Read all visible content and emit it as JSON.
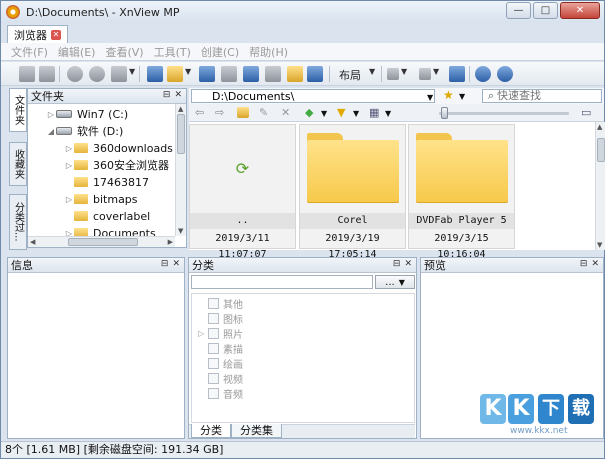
{
  "window": {
    "title": "D:\\Documents\\ - XnView MP",
    "min_label": "—",
    "max_label": "□",
    "close_label": "✕"
  },
  "tabs": [
    {
      "label": "浏览器",
      "close": "✕"
    }
  ],
  "menu": [
    "文件(F)",
    "编辑(E)",
    "查看(V)",
    "工具(T)",
    "创建(C)",
    "帮助(H)"
  ],
  "toolbar": {
    "layout_label": "布局"
  },
  "sidebar": {
    "vertical_tabs": [
      "文件夹",
      "收藏夹",
      "分类过..."
    ],
    "folder_panel": {
      "title": "文件夹",
      "items": [
        {
          "label": "Win7 (C:)",
          "type": "drive",
          "arrow": "▷",
          "indent": 1
        },
        {
          "label": "软件 (D:)",
          "type": "drive",
          "arrow": "◢",
          "indent": 1
        },
        {
          "label": "360downloads",
          "type": "folder",
          "arrow": "▷",
          "indent": 2
        },
        {
          "label": "360安全浏览器",
          "type": "folder",
          "arrow": "▷",
          "indent": 2
        },
        {
          "label": "17463817",
          "type": "folder",
          "arrow": "",
          "indent": 2
        },
        {
          "label": "bitmaps",
          "type": "folder",
          "arrow": "▷",
          "indent": 2
        },
        {
          "label": "coverlabel",
          "type": "folder",
          "arrow": "",
          "indent": 2
        },
        {
          "label": "Documents",
          "type": "folder",
          "arrow": "▷",
          "indent": 2
        }
      ]
    }
  },
  "address": {
    "path": "D:\\Documents\\",
    "search_placeholder": "快速查找"
  },
  "thumbnails": [
    {
      "name": "..",
      "date": "2019/3/11 11:07:07",
      "kind": "parent"
    },
    {
      "name": "Corel",
      "date": "2019/3/19 17:05:14",
      "kind": "folder"
    },
    {
      "name": "DVDFab Player 5",
      "date": "2019/3/15 10:16:04",
      "kind": "folder"
    }
  ],
  "panels": {
    "info": {
      "title": "信息"
    },
    "category": {
      "title": "分类",
      "dots_label": "...",
      "items": [
        {
          "label": "其他",
          "arrow": ""
        },
        {
          "label": "图标",
          "arrow": ""
        },
        {
          "label": "照片",
          "arrow": "▷"
        },
        {
          "label": "素描",
          "arrow": ""
        },
        {
          "label": "绘画",
          "arrow": ""
        },
        {
          "label": "视频",
          "arrow": ""
        },
        {
          "label": "音频",
          "arrow": ""
        }
      ],
      "bottom_tabs": [
        "分类",
        "分类集"
      ]
    },
    "preview": {
      "title": "预览"
    }
  },
  "status": "8个 [1.61 MB] [剩余磁盘空间: 191.34 GB]",
  "watermark": {
    "letters": [
      "K",
      "K",
      "下",
      "载"
    ],
    "url": "www.kkx.net"
  },
  "colors": {
    "accent": "#dbe4ee",
    "folder": "#f7c94a",
    "close": "#c4453a"
  }
}
